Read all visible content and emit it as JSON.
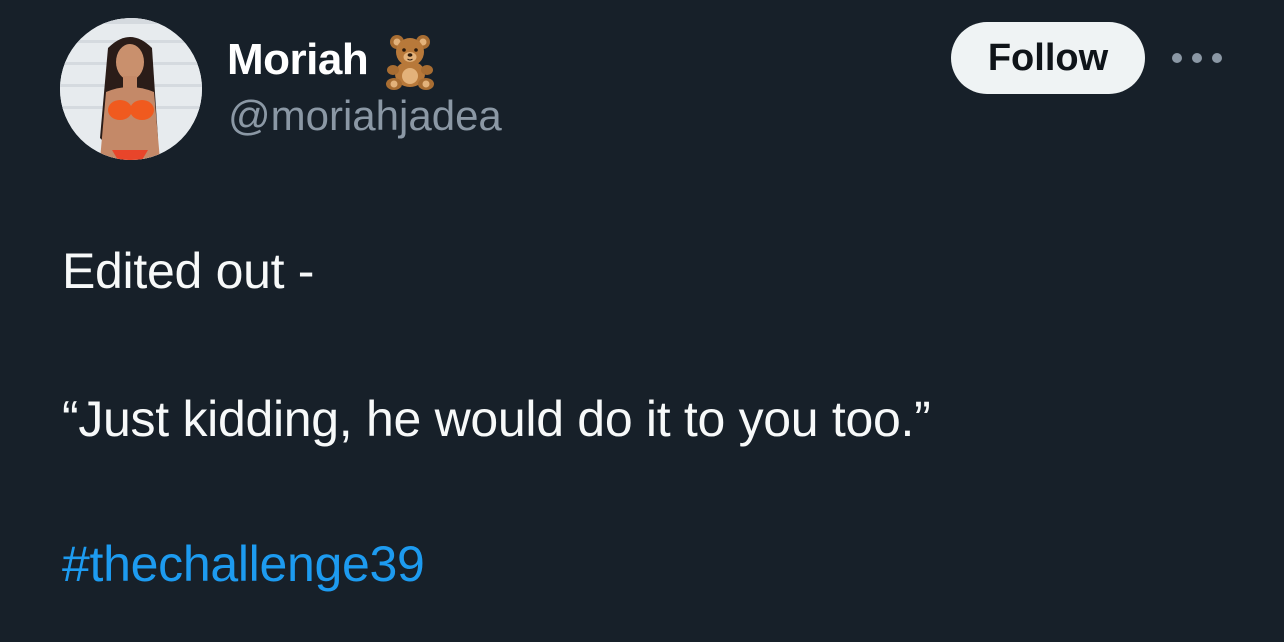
{
  "author": {
    "display_name": "Moriah",
    "name_emoji": "bear-icon",
    "handle": "@moriahjadea",
    "avatar": "profile-photo"
  },
  "actions": {
    "follow_label": "Follow",
    "more_icon": "more-options-icon"
  },
  "tweet": {
    "line1": "Edited out -",
    "line2": "“Just kidding, he would do it to you too.”",
    "hashtag": "#thechallenge39"
  },
  "colors": {
    "background": "#15202b",
    "text": "#f7f9f9",
    "secondary_text": "#8b98a5",
    "link": "#1d9bf0",
    "follow_bg": "#eff3f4"
  }
}
